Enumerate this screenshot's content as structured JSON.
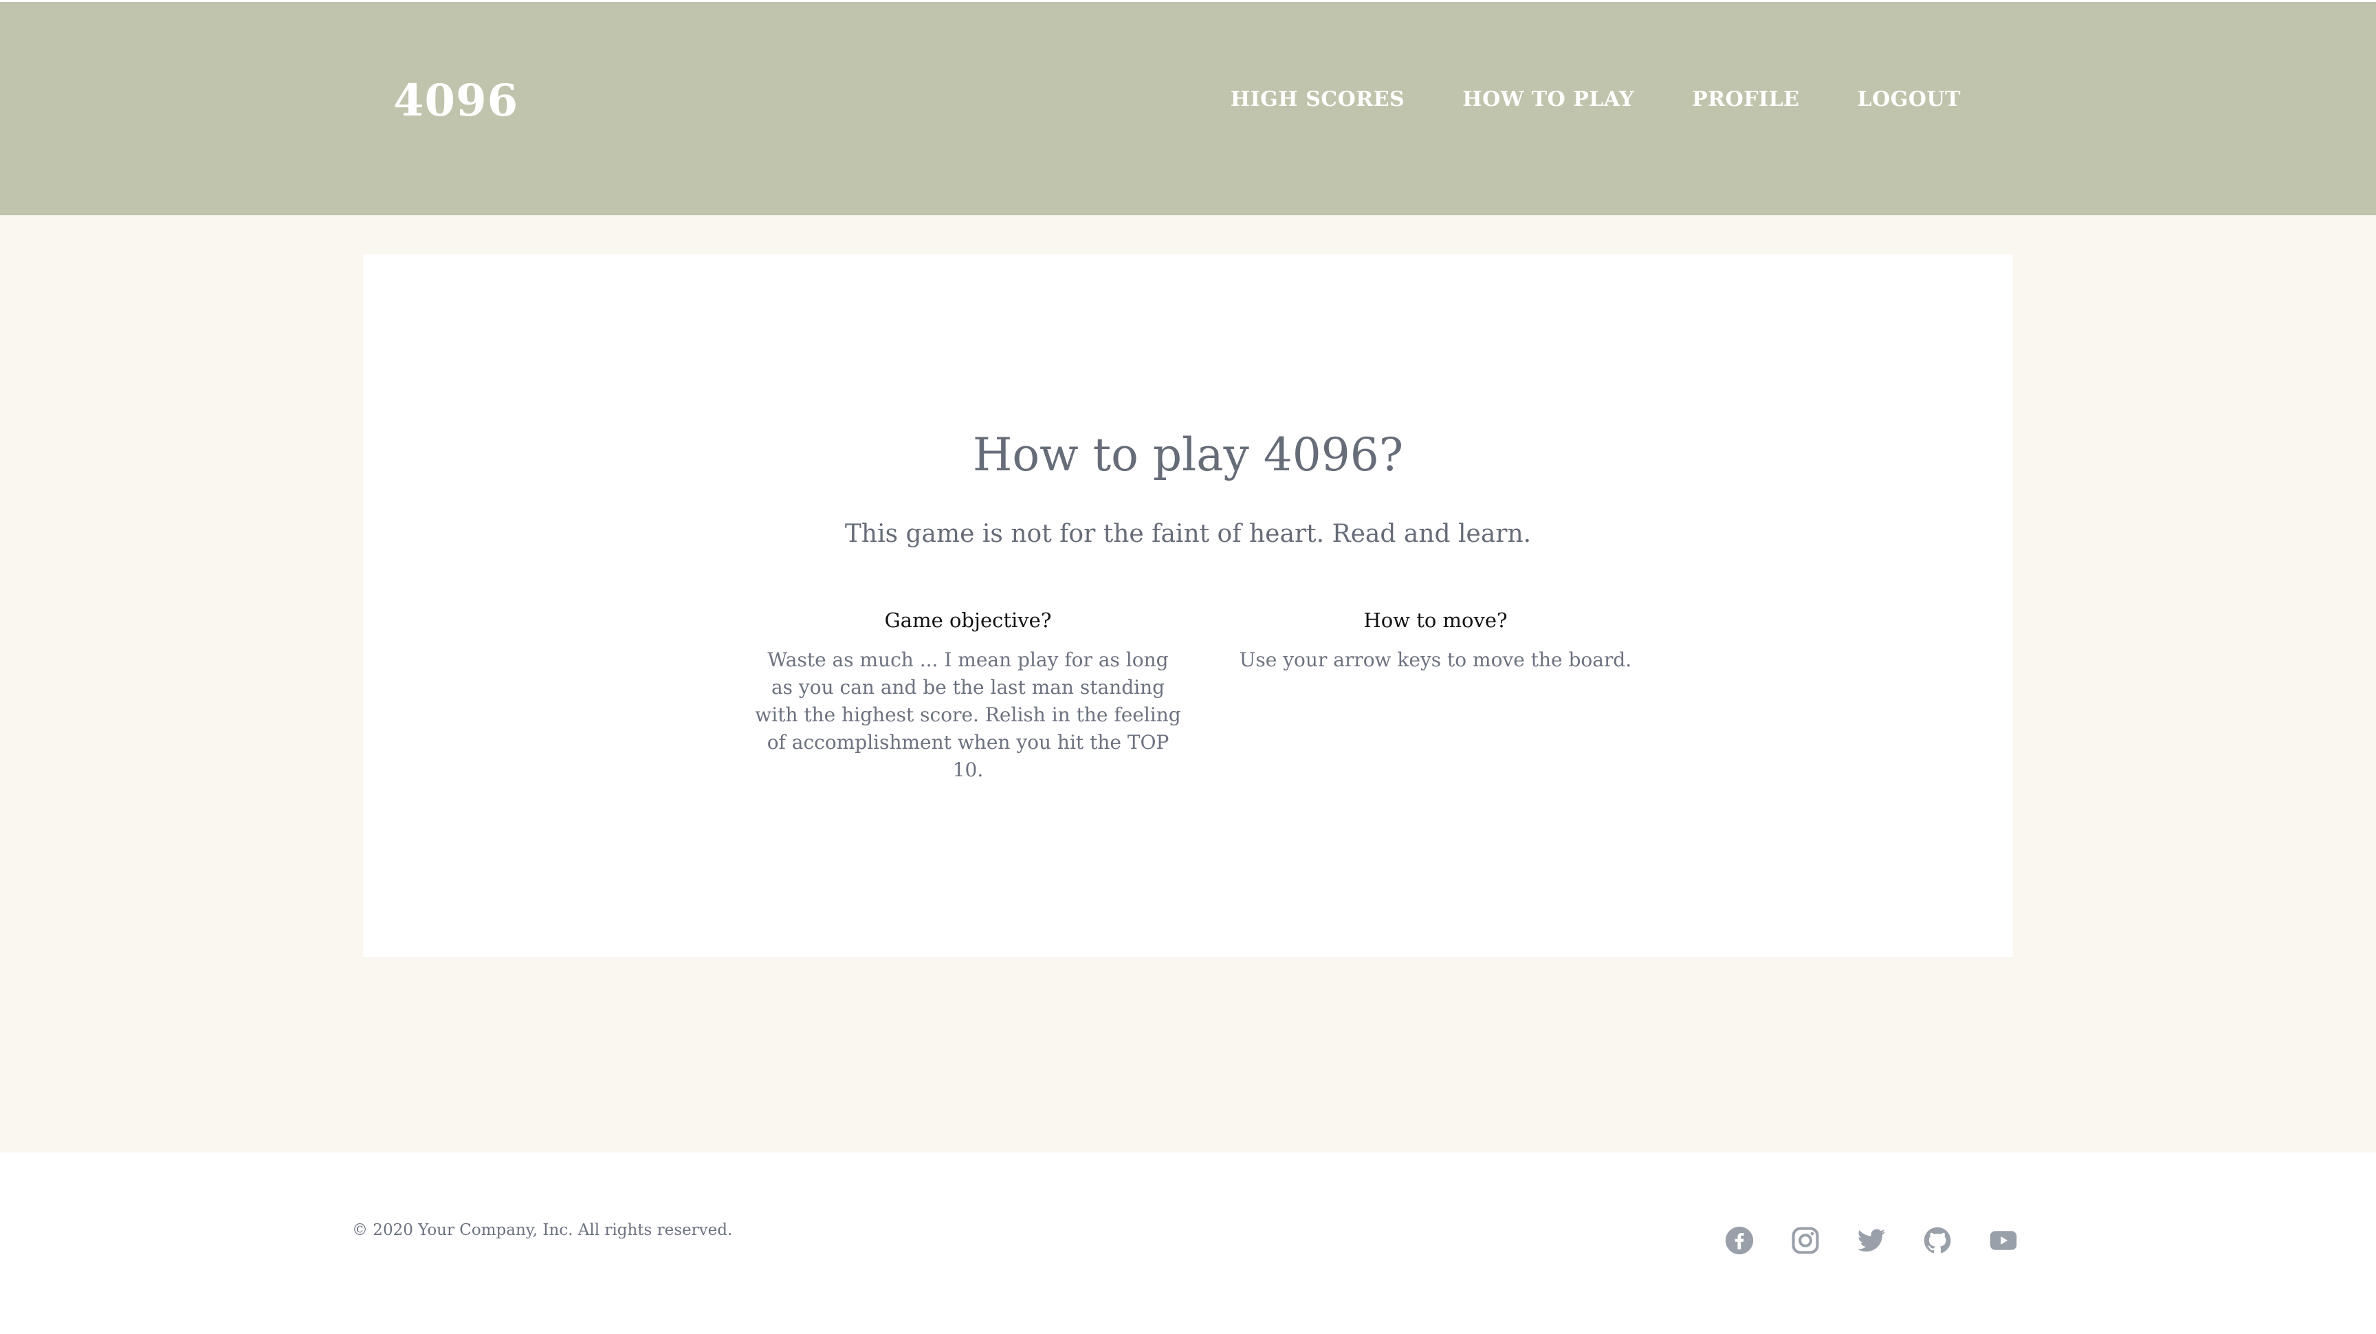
{
  "header": {
    "brand": "4096",
    "nav": [
      {
        "label": "HIGH SCORES"
      },
      {
        "label": "HOW TO PLAY"
      },
      {
        "label": "PROFILE"
      },
      {
        "label": "LOGOUT"
      }
    ]
  },
  "main": {
    "title": "How to play 4096?",
    "subtitle": "This game is not for the faint of heart. Read and learn.",
    "sections": [
      {
        "heading": "Game objective?",
        "body": "Waste as much ... I mean play for as long as you can and be the last man standing with the highest score. Relish in the feeling of accomplishment when you hit the TOP 10."
      },
      {
        "heading": "How to move?",
        "body": "Use your arrow keys to move the board."
      }
    ]
  },
  "footer": {
    "copyright": "© 2020 Your Company, Inc. All rights reserved.",
    "social_icons": [
      "facebook-icon",
      "instagram-icon",
      "twitter-icon",
      "github-icon",
      "youtube-icon"
    ],
    "icon_color": "#9aa0aa"
  },
  "colors": {
    "header_bg": "#c1c4ac",
    "page_bg": "#faf7f0",
    "card_bg": "#ffffff",
    "text_gray": "#666c78"
  }
}
